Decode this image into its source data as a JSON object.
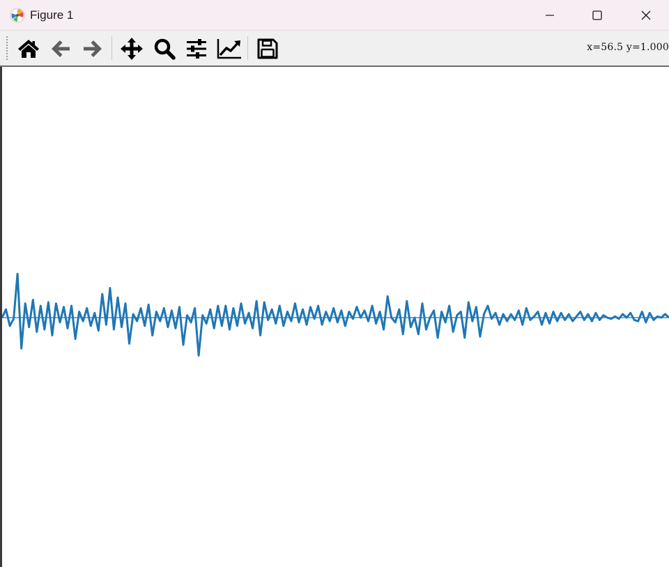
{
  "window": {
    "title": "Figure 1",
    "icons": {
      "app": "matplotlib-icon",
      "minimize": "minimize-icon",
      "maximize": "maximize-icon",
      "close": "close-icon"
    }
  },
  "toolbar": {
    "buttons": [
      {
        "name": "home-button",
        "icon": "home-icon",
        "tooltip": "Home"
      },
      {
        "name": "back-button",
        "icon": "arrow-left-icon",
        "tooltip": "Back"
      },
      {
        "name": "forward-button",
        "icon": "arrow-right-icon",
        "tooltip": "Forward"
      },
      {
        "name": "pan-button",
        "icon": "move-icon",
        "tooltip": "Pan"
      },
      {
        "name": "zoom-button",
        "icon": "magnifier-icon",
        "tooltip": "Zoom"
      },
      {
        "name": "subplots-button",
        "icon": "sliders-icon",
        "tooltip": "Subplots"
      },
      {
        "name": "edit-axis-button",
        "icon": "line-chart-icon",
        "tooltip": "Customize"
      },
      {
        "name": "save-button",
        "icon": "floppy-disk-icon",
        "tooltip": "Save"
      }
    ],
    "coordinates": "x=56.5 y=1.000"
  },
  "colors": {
    "line": "#1f77b4",
    "titlebar": "#f7eef3",
    "toolbar": "#f0f0f0"
  },
  "chart_data": {
    "type": "line",
    "axes_visible": false,
    "grid": false,
    "baseline_y": 1.0,
    "series": [
      {
        "values": [
          1.0,
          1.07,
          0.93,
          0.99,
          1.37,
          0.74,
          1.12,
          0.92,
          1.15,
          0.88,
          1.1,
          0.9,
          1.13,
          0.85,
          1.12,
          0.96,
          1.09,
          0.91,
          1.1,
          0.82,
          1.05,
          0.97,
          1.08,
          0.93,
          1.04,
          0.89,
          1.2,
          0.94,
          1.25,
          0.9,
          1.17,
          0.92,
          1.12,
          0.78,
          1.03,
          0.97,
          1.08,
          0.93,
          1.11,
          0.85,
          1.05,
          0.97,
          1.08,
          0.92,
          1.06,
          0.91,
          1.09,
          0.77,
          1.02,
          0.96,
          1.08,
          0.68,
          1.02,
          0.95,
          1.07,
          0.91,
          1.1,
          0.93,
          1.1,
          0.9,
          1.08,
          0.93,
          1.12,
          0.95,
          1.04,
          0.91,
          1.14,
          0.85,
          1.13,
          0.98,
          1.07,
          0.95,
          1.1,
          0.93,
          1.05,
          0.97,
          1.12,
          0.96,
          1.07,
          0.94,
          1.09,
          0.99,
          1.1,
          0.94,
          1.05,
          0.97,
          1.08,
          0.96,
          1.06,
          0.93,
          1.05,
          0.99,
          1.09,
          1.0,
          1.06,
          0.97,
          1.1,
          0.95,
          1.05,
          0.9,
          1.18,
          1.0,
          0.96,
          1.07,
          0.86,
          1.14,
          0.92,
          1.0,
          0.86,
          1.12,
          0.9,
          1.0,
          1.06,
          0.83,
          1.05,
          0.96,
          1.1,
          0.88,
          1.02,
          1.05,
          0.83,
          1.13,
          0.97,
          1.09,
          0.84,
          1.03,
          1.1,
          0.99,
          1.04,
          0.94,
          1.03,
          0.97,
          1.03,
          0.98,
          1.06,
          0.94,
          1.08,
          0.98,
          1.01,
          1.05,
          0.94,
          1.04,
          0.95,
          1.05,
          0.97,
          1.04,
          0.98,
          1.03,
          0.97,
          1.01,
          1.05,
          0.98,
          1.03,
          0.97,
          1.04,
          0.98,
          1.02,
          1.0,
          0.99,
          1.01,
          0.99,
          1.03,
          1.0,
          1.04,
          0.98,
          0.97,
          1.05,
          0.96,
          1.04,
          0.98,
          1.01,
          1.0,
          1.03,
          1.0
        ],
        "x_start": 0,
        "x_step": 1
      }
    ]
  }
}
